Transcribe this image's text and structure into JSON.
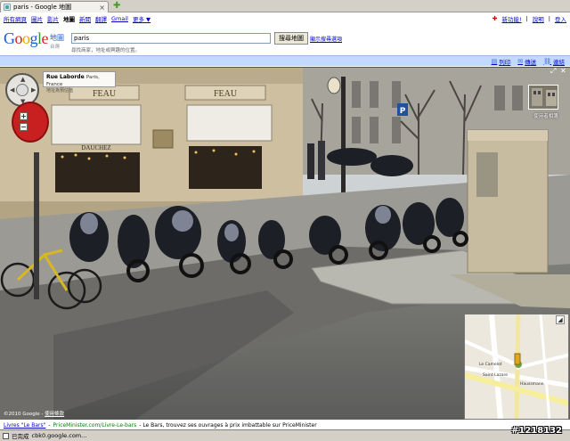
{
  "browser": {
    "tab_title": "paris - Google 地圖",
    "status_text": "已完成",
    "status_url": "cbk0.google.com..."
  },
  "gbar": {
    "left_links": [
      "所有網頁",
      "圖片",
      "影片",
      "地圖",
      "新聞",
      "翻譯",
      "Gmail",
      "更多 ▼"
    ],
    "current_index": 3,
    "right_links": [
      "",
      "新功能!",
      "說明",
      "登入"
    ]
  },
  "header": {
    "logo": "Google",
    "product": "地圖",
    "region": "台灣",
    "search_value": "paris",
    "search_button": "搜尋地圖",
    "search_options": "顯示搜尋選項",
    "search_hint": "尋找商家，地址或興趣的位置。"
  },
  "toolbar": {
    "items": [
      "列印",
      "傳送",
      "連結"
    ]
  },
  "street_view": {
    "address_street": "Rue Laborde",
    "address_city": "Paris, France",
    "address_sub": "地址為預估值",
    "thumb_caption": "使用者相簿",
    "copyright": "©2010 Google",
    "copyright_link": "使用條款",
    "shop_signs": [
      "FEAU",
      "FEAU",
      "DAUCHEZ"
    ],
    "minimap_labels": [
      "Le Camelot",
      "Saint-Lazare",
      "Haussmann"
    ]
  },
  "ad": {
    "link": "Livres \"Le Bars\"",
    "url": "PriceMinister.com/Livre-Le-bars",
    "text": "- Le Bars, trouvez ses ouvrages à prix imbattable sur PriceMinister"
  },
  "watermark": "#1218132",
  "colors": {
    "accent": "#0000cc",
    "toolbar_bg": "#c3d9ff",
    "zoom_red": "#c82020"
  }
}
